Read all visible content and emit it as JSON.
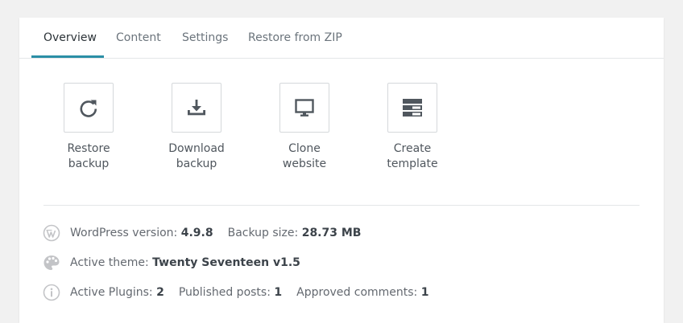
{
  "tabs": [
    {
      "label": "Overview",
      "active": true
    },
    {
      "label": "Content",
      "active": false
    },
    {
      "label": "Settings",
      "active": false
    },
    {
      "label": "Restore from ZIP",
      "active": false
    }
  ],
  "actions": [
    {
      "line1": "Restore",
      "line2": "backup",
      "icon": "restore-icon"
    },
    {
      "line1": "Download",
      "line2": "backup",
      "icon": "download-icon"
    },
    {
      "line1": "Clone",
      "line2": "website",
      "icon": "monitor-icon"
    },
    {
      "line1": "Create",
      "line2": "template",
      "icon": "template-icon"
    }
  ],
  "info": {
    "wp_version_label": "WordPress version:",
    "wp_version_value": "4.9.8",
    "backup_size_label": "Backup size:",
    "backup_size_value": "28.73 MB",
    "theme_label": "Active theme:",
    "theme_value": "Twenty Seventeen v1.5",
    "plugins_label": "Active Plugins:",
    "plugins_value": "2",
    "posts_label": "Published posts:",
    "posts_value": "1",
    "comments_label": "Approved comments:",
    "comments_value": "1"
  },
  "colors": {
    "accent": "#2b8fa6",
    "icon": "#50575e",
    "muted_icon": "#c3c4c7"
  }
}
